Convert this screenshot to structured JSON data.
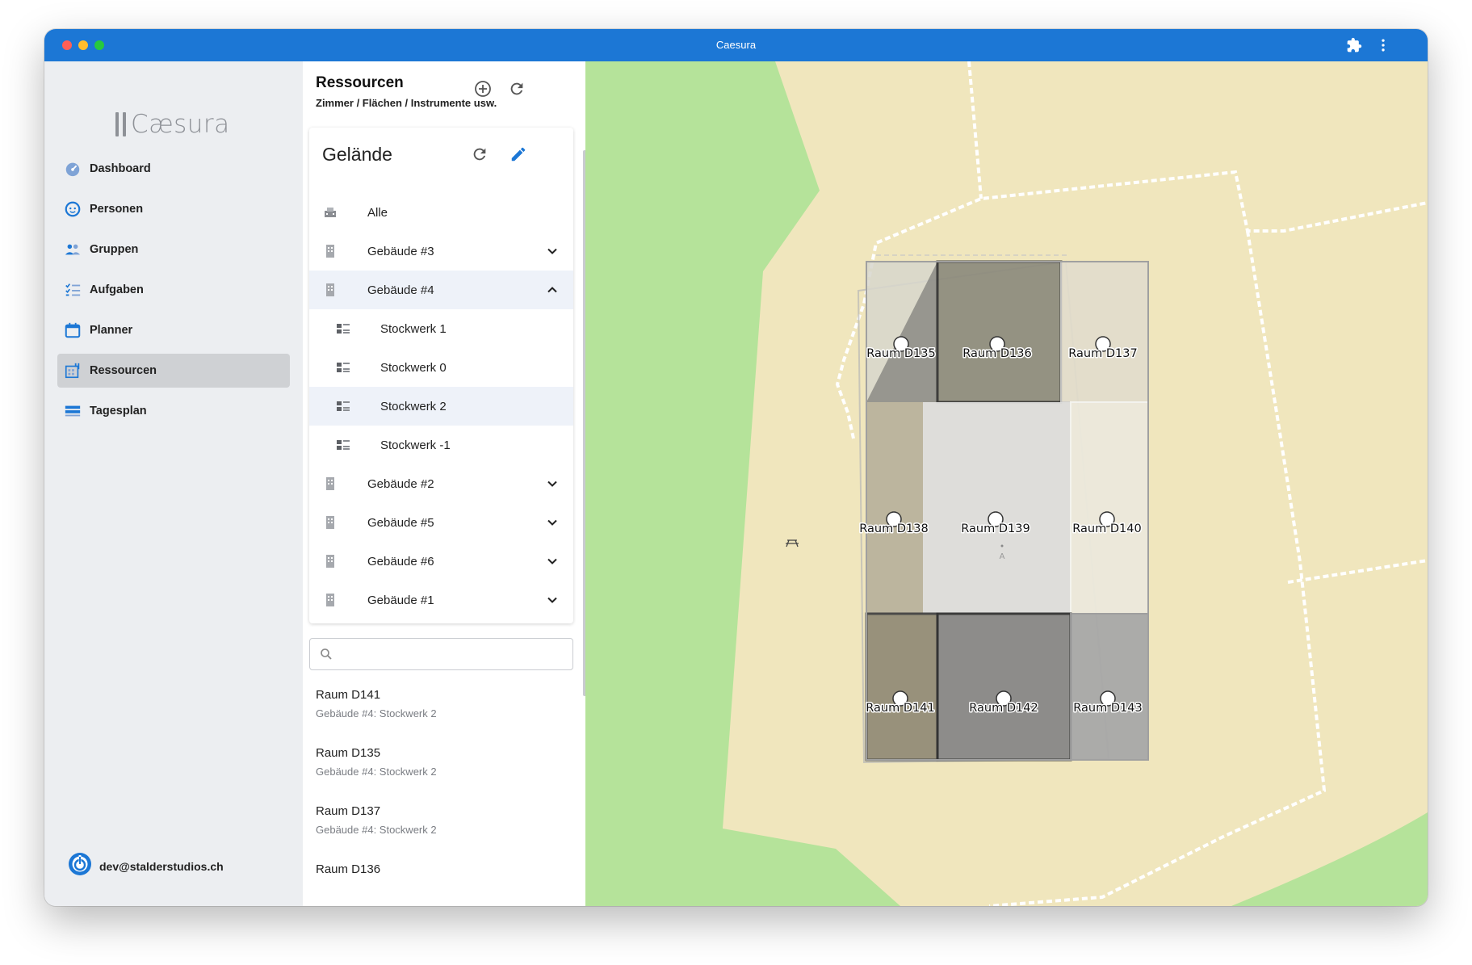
{
  "window": {
    "title": "Caesura"
  },
  "sidebar": {
    "logo": "Cæsura",
    "items": [
      {
        "label": "Dashboard",
        "icon": "dashboard-icon"
      },
      {
        "label": "Personen",
        "icon": "person-icon"
      },
      {
        "label": "Gruppen",
        "icon": "group-icon"
      },
      {
        "label": "Aufgaben",
        "icon": "tasks-icon"
      },
      {
        "label": "Planner",
        "icon": "calendar-icon"
      },
      {
        "label": "Ressourcen",
        "icon": "resources-icon",
        "active": true
      },
      {
        "label": "Tagesplan",
        "icon": "dayplan-icon"
      }
    ],
    "user": "dev@stalderstudios.ch"
  },
  "panel": {
    "title": "Ressourcen",
    "subtitle": "Zimmer / Flächen / Instrumente usw.",
    "card": {
      "title": "Gelände",
      "rows": [
        {
          "label": "Alle",
          "icon": "campus-icon"
        },
        {
          "label": "Gebäude #3",
          "icon": "building-icon",
          "chevron": "down"
        },
        {
          "label": "Gebäude #4",
          "icon": "building-icon",
          "chevron": "up",
          "highlighted": true
        },
        {
          "label": "Stockwerk 1",
          "icon": "floor-icon",
          "child": true
        },
        {
          "label": "Stockwerk 0",
          "icon": "floor-icon",
          "child": true
        },
        {
          "label": "Stockwerk 2",
          "icon": "floor-icon",
          "child": true,
          "highlighted": true
        },
        {
          "label": "Stockwerk -1",
          "icon": "floor-icon",
          "child": true
        },
        {
          "label": "Gebäude #2",
          "icon": "building-icon",
          "chevron": "down"
        },
        {
          "label": "Gebäude #5",
          "icon": "building-icon",
          "chevron": "down"
        },
        {
          "label": "Gebäude #6",
          "icon": "building-icon",
          "chevron": "down"
        },
        {
          "label": "Gebäude #1",
          "icon": "building-icon",
          "chevron": "down"
        }
      ]
    },
    "search": {
      "value": "",
      "placeholder": ""
    },
    "results": [
      {
        "title": "Raum D141",
        "subtitle": "Gebäude #4: Stockwerk 2"
      },
      {
        "title": "Raum D135",
        "subtitle": "Gebäude #4: Stockwerk 2"
      },
      {
        "title": "Raum D137",
        "subtitle": "Gebäude #4: Stockwerk 2"
      },
      {
        "title": "Raum D136",
        "subtitle": ""
      }
    ]
  },
  "map": {
    "rooms": [
      "Raum D135",
      "Raum D136",
      "Raum D137",
      "Raum D138",
      "Raum D139",
      "Raum D140",
      "Raum D141",
      "Raum D142",
      "Raum D143"
    ],
    "marker": "A"
  },
  "colors": {
    "accent": "#1c77d5",
    "terrain": "#b5e39a",
    "area": "#f0e6bd"
  }
}
